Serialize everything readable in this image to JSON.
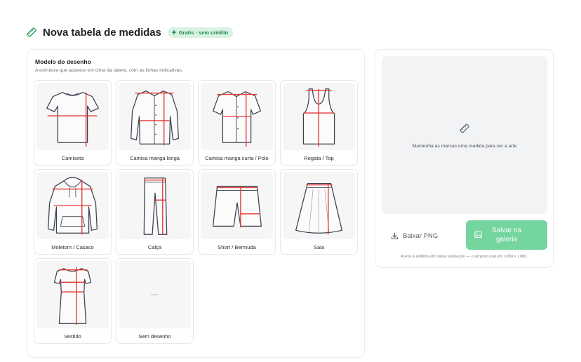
{
  "header": {
    "title": "Nova tabela de medidas",
    "badge": "Gratis · sem crédito"
  },
  "model_section": {
    "title": "Modelo do desenho",
    "subtitle": "A estrutura que aparece em cima da tabela, com as linhas indicativas."
  },
  "garments": [
    {
      "label": "Camiseta",
      "icon": "tshirt-icon"
    },
    {
      "label": "Camisa manga longa",
      "icon": "long-sleeve-shirt-icon"
    },
    {
      "label": "Camisa manga curta / Polo",
      "icon": "short-sleeve-shirt-icon"
    },
    {
      "label": "Regata / Top",
      "icon": "tank-top-icon"
    },
    {
      "label": "Moletom / Casaco",
      "icon": "hoodie-icon"
    },
    {
      "label": "Calça",
      "icon": "pants-icon"
    },
    {
      "label": "Short / Bermuda",
      "icon": "shorts-icon"
    },
    {
      "label": "Saia",
      "icon": "skirt-icon"
    },
    {
      "label": "Vestido",
      "icon": "dress-icon"
    },
    {
      "label": "Sem desenho",
      "icon": "dash-icon",
      "placeholder": "—"
    }
  ],
  "preview": {
    "message": "Mantenha as marcas uma medida para ver a arte"
  },
  "actions": {
    "download_label": "Baixar PNG",
    "save_label": "Salvar na galeria"
  },
  "footnote": "A arte é exibida em baixa resolução — o arquivo real em 1080 × 1080.",
  "colors": {
    "accent": "#74d59f",
    "badge_bg": "#d9f2e3",
    "badge_text": "#1f8a4c",
    "measure_line": "#e53935"
  }
}
